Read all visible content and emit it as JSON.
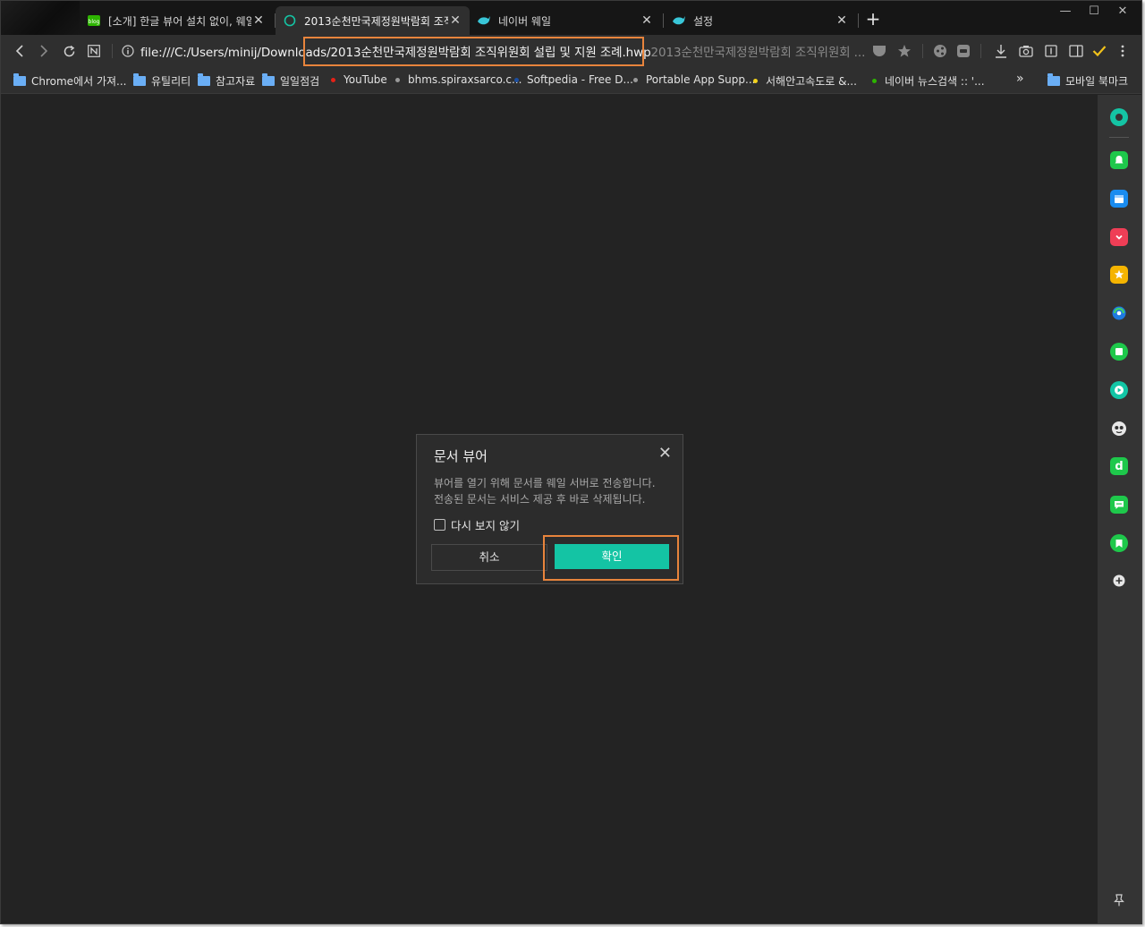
{
  "tabs": [
    {
      "title": "[소개] 한글 뷰어 설치 없이, 웨일",
      "favicon": "naver-blog-icon",
      "active": false
    },
    {
      "title": "2013순천만국제정원박람회 조직",
      "favicon": "loading-ring-icon",
      "active": true
    },
    {
      "title": "네이버 웨일",
      "favicon": "whale-icon",
      "active": false
    },
    {
      "title": "설정",
      "favicon": "whale-icon",
      "active": false
    }
  ],
  "window_controls": {
    "minimize": "—",
    "maximize": "☐",
    "close": "✕"
  },
  "newtab_label": "+",
  "address": {
    "prefix": "file:///C:/Users/minij/Download",
    "highlighted": "s/2013순천만국제정원박람회 조직위원회 설립 및 지원 조례.hwp",
    "suggestion": "2013순천만국제정원박람회 조직위원회 ..."
  },
  "bookmarks": [
    {
      "label": "Chrome에서 가져...",
      "type": "folder"
    },
    {
      "label": "유틸리티",
      "type": "folder"
    },
    {
      "label": "참고자료",
      "type": "folder"
    },
    {
      "label": "일일점검",
      "type": "folder"
    },
    {
      "label": "YouTube",
      "type": "site",
      "color": "#e62117"
    },
    {
      "label": "bhms.spiraxsarco.c...",
      "type": "site",
      "color": "#9a9a9a"
    },
    {
      "label": "Softpedia - Free D...",
      "type": "site",
      "color": "#1c4fa0"
    },
    {
      "label": "Portable App Supp...",
      "type": "site",
      "color": "#9a9a9a"
    },
    {
      "label": "서해안고속도로 &...",
      "type": "site",
      "color": "#f2d21a"
    },
    {
      "label": "네이버 뉴스검색 :: '...",
      "type": "site",
      "color": "#2db400"
    }
  ],
  "bookmarks_overflow": "»",
  "mobile_bookmarks": "모바일 북마크",
  "dialog": {
    "title": "문서 뷰어",
    "close": "✕",
    "message_line1": "뷰어를 열기 위해 문서를 웨일 서버로 전송합니다.",
    "message_line2": "전송된 문서는 서비스 제공 후 바로 삭제됩니다.",
    "checkbox_label": "다시 보지 않기",
    "cancel_label": "취소",
    "ok_label": "확인"
  },
  "sidebar_icons": [
    "whale-space-icon",
    "alarm-icon",
    "calendar-icon",
    "pocket-icon",
    "favorites-icon",
    "translate-icon",
    "memo-icon",
    "video-icon",
    "papago-icon",
    "dictionary-icon",
    "talk-icon",
    "bookmark-icon",
    "add-icon",
    "pin-icon"
  ],
  "colors": {
    "accent": "#14c4a4",
    "highlight": "#e8843c",
    "background": "#232323"
  }
}
